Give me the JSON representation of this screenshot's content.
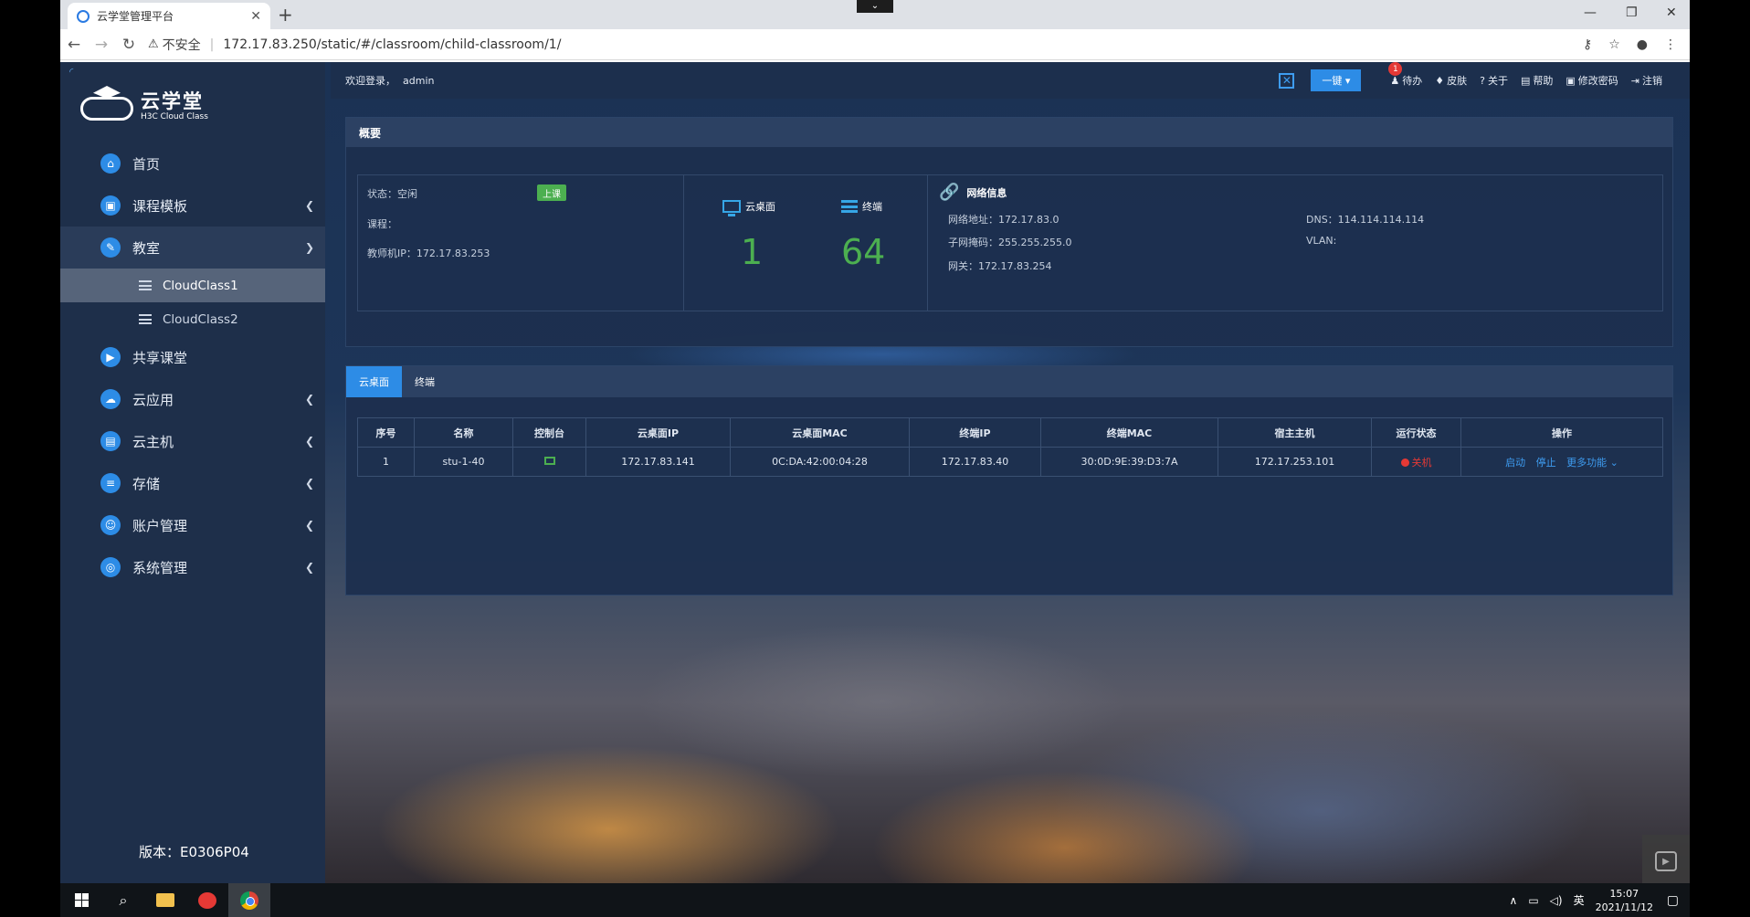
{
  "browser": {
    "tab_title": "云学堂管理平台",
    "tab_close": "✕",
    "new_tab": "+",
    "center_chevron": "⌄",
    "win_minimize": "—",
    "win_restore": "❐",
    "win_close": "✕",
    "security_label": "不安全",
    "url": "172.17.83.250/static/#/classroom/child-classroom/1/"
  },
  "sidebar": {
    "logo_title": "云学堂",
    "logo_subtitle": "H3C Cloud Class",
    "items": [
      {
        "label": "首页",
        "icon": "⌂"
      },
      {
        "label": "课程模板",
        "icon": "▣"
      },
      {
        "label": "教室",
        "icon": "✎"
      },
      {
        "label": "共享课堂",
        "icon": "▶"
      },
      {
        "label": "云应用",
        "icon": "☁"
      },
      {
        "label": "云主机",
        "icon": "▤"
      },
      {
        "label": "存储",
        "icon": "≡"
      },
      {
        "label": "账户管理",
        "icon": "☺"
      },
      {
        "label": "系统管理",
        "icon": "◎"
      }
    ],
    "sub_items": [
      "CloudClass1",
      "CloudClass2"
    ],
    "version": "版本：E0306P04"
  },
  "topbar": {
    "welcome": "欢迎登录，",
    "username": "admin",
    "one_key": "一键",
    "todo_badge": "1",
    "todo": "待办",
    "skin": "皮肤",
    "about": "关于",
    "help": "帮助",
    "change_password": "修改密码",
    "logout": "注销"
  },
  "overview": {
    "title": "概要",
    "status": "状态：空闲",
    "start_button": "上课",
    "course": "课程：",
    "teacher_ip": "教师机IP：172.17.83.253",
    "desktop_label": "云桌面",
    "desktop_count": "1",
    "terminal_label": "终端",
    "terminal_count": "64",
    "network_title": "网络信息",
    "network_address": "网络地址：172.17.83.0",
    "subnet_mask": "子网掩码：255.255.255.0",
    "gateway": "网关：172.17.83.254",
    "dns": "DNS：114.114.114.114",
    "vlan": "VLAN:"
  },
  "table": {
    "tabs": [
      "云桌面",
      "终端"
    ],
    "columns": [
      "序号",
      "名称",
      "控制台",
      "云桌面IP",
      "云桌面MAC",
      "终端IP",
      "终端MAC",
      "宿主主机",
      "运行状态",
      "操作"
    ],
    "rows": [
      {
        "index": "1",
        "name": "stu-1-40",
        "desktop_ip": "172.17.83.141",
        "desktop_mac": "0C:DA:42:00:04:28",
        "terminal_ip": "172.17.83.40",
        "terminal_mac": "30:0D:9E:39:D3:7A",
        "host": "172.17.253.101",
        "status": "关机",
        "ops": [
          "启动",
          "停止",
          "更多功能"
        ]
      }
    ]
  },
  "taskbar": {
    "ime": "英",
    "time": "15:07",
    "date": "2021/11/12"
  },
  "colors": {
    "accent": "#2d8ce6",
    "success": "#4caf50",
    "danger": "#e53935",
    "sidebar_bg": "#1e2f4a"
  }
}
